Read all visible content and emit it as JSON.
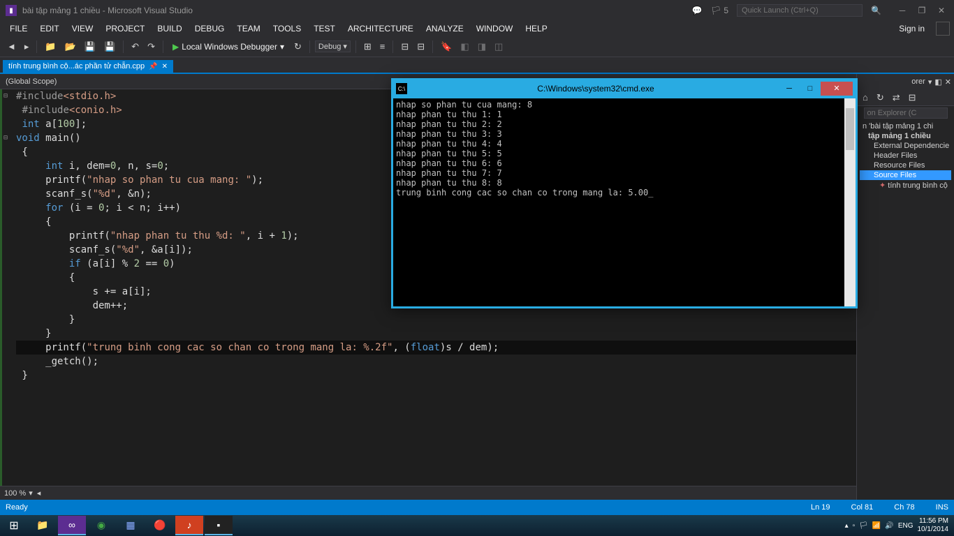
{
  "title": "bài tập mảng 1 chiều - Microsoft Visual Studio",
  "notif_count": "5",
  "quick_launch_placeholder": "Quick Launch (Ctrl+Q)",
  "menu": [
    "FILE",
    "EDIT",
    "VIEW",
    "PROJECT",
    "BUILD",
    "DEBUG",
    "TEAM",
    "TOOLS",
    "TEST",
    "ARCHITECTURE",
    "ANALYZE",
    "WINDOW",
    "HELP"
  ],
  "signin": "Sign in",
  "debugger_label": "Local Windows Debugger",
  "config_label": "Debug",
  "tab_name": "tính trung bình cộ...ác phần tử chẵn.cpp",
  "scope": "(Global Scope)",
  "zoom": "100 %",
  "status_ready": "Ready",
  "status_ln": "Ln 19",
  "status_col": "Col 81",
  "status_ch": "Ch 78",
  "status_ins": "INS",
  "panel_label": "orer",
  "search_sol_placeholder": "on Explorer (C",
  "tree": {
    "sol": "n 'bài tập mảng 1 chi",
    "proj": "tập mảng 1 chiều",
    "ext": "External Dependencie",
    "hdr": "Header Files",
    "res": "Resource Files",
    "src": "Source Files",
    "file": "tính trung bình cộ"
  },
  "cmd_title": "C:\\Windows\\system32\\cmd.exe",
  "cmd_lines": [
    "nhap so phan tu cua mang: 8",
    "nhap phan tu thu 1: 1",
    "nhap phan tu thu 2: 2",
    "nhap phan tu thu 3: 3",
    "nhap phan tu thu 4: 4",
    "nhap phan tu thu 5: 5",
    "nhap phan tu thu 6: 6",
    "nhap phan tu thu 7: 7",
    "nhap phan tu thu 8: 8",
    "trung binh cong cac so chan co trong mang la: 5.00_"
  ],
  "tray_lang": "ENG",
  "tray_time": "11:56 PM",
  "tray_date": "10/1/2014"
}
